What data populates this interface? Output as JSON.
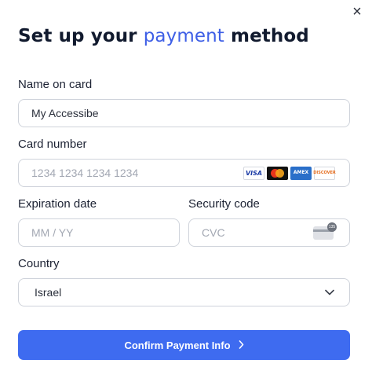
{
  "dialog": {
    "close_label": "×",
    "title_part1": "Set up your ",
    "title_accent": "payment",
    "title_part2": " method",
    "accent_color": "#3e5fe6"
  },
  "form": {
    "name_label": "Name on card",
    "name_value": "My Accessibe",
    "card_label": "Card number",
    "card_placeholder": "1234 1234 1234 1234",
    "card_brands": [
      "VISA",
      "mastercard",
      "AMEX",
      "DISCOVER"
    ],
    "expiry_label": "Expiration date",
    "expiry_placeholder": "MM / YY",
    "security_label": "Security code",
    "security_placeholder": "CVC",
    "cvc_badge": "135",
    "country_label": "Country",
    "country_value": "Israel"
  },
  "confirm": {
    "label": "Confirm Payment Info",
    "color": "#3e6bf0"
  }
}
